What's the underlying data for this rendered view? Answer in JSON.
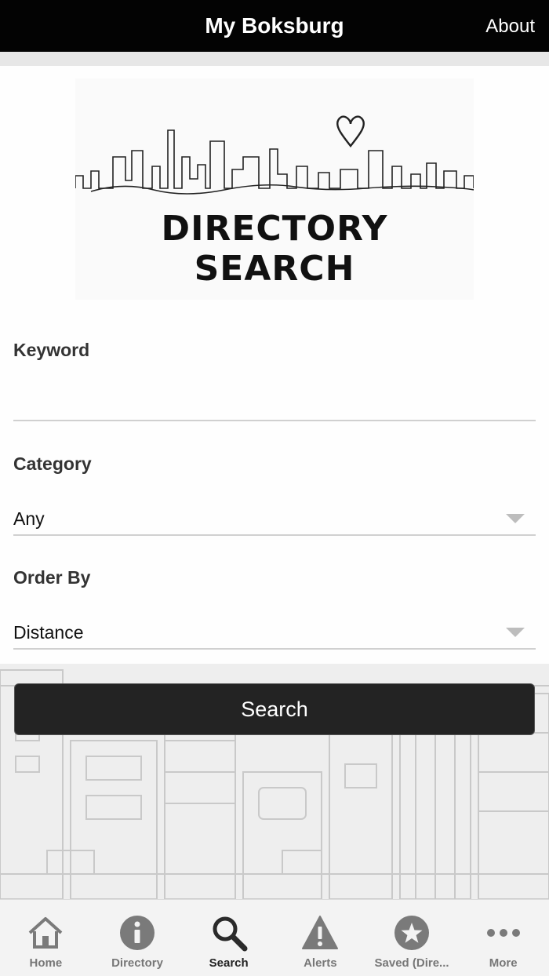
{
  "header": {
    "title": "My Boksburg",
    "about_label": "About"
  },
  "logo": {
    "text": "DIRECTORY SEARCH"
  },
  "form": {
    "keyword": {
      "label": "Keyword",
      "value": "",
      "placeholder": ""
    },
    "category": {
      "label": "Category",
      "value": "Any"
    },
    "order_by": {
      "label": "Order By",
      "value": "Distance"
    },
    "search_label": "Search"
  },
  "tabbar": {
    "active": "Search",
    "tabs": [
      {
        "label": "Home",
        "icon": "home-icon"
      },
      {
        "label": "Directory",
        "icon": "info-icon"
      },
      {
        "label": "Search",
        "icon": "search-icon"
      },
      {
        "label": "Alerts",
        "icon": "alert-icon"
      },
      {
        "label": "Saved (Dire...",
        "icon": "star-icon"
      },
      {
        "label": "More",
        "icon": "more-icon"
      }
    ]
  },
  "colors": {
    "header_bg": "#030303",
    "button_bg": "#232323",
    "tab_icon": "#7a7a7a",
    "tab_icon_active": "#2a2a2a"
  }
}
